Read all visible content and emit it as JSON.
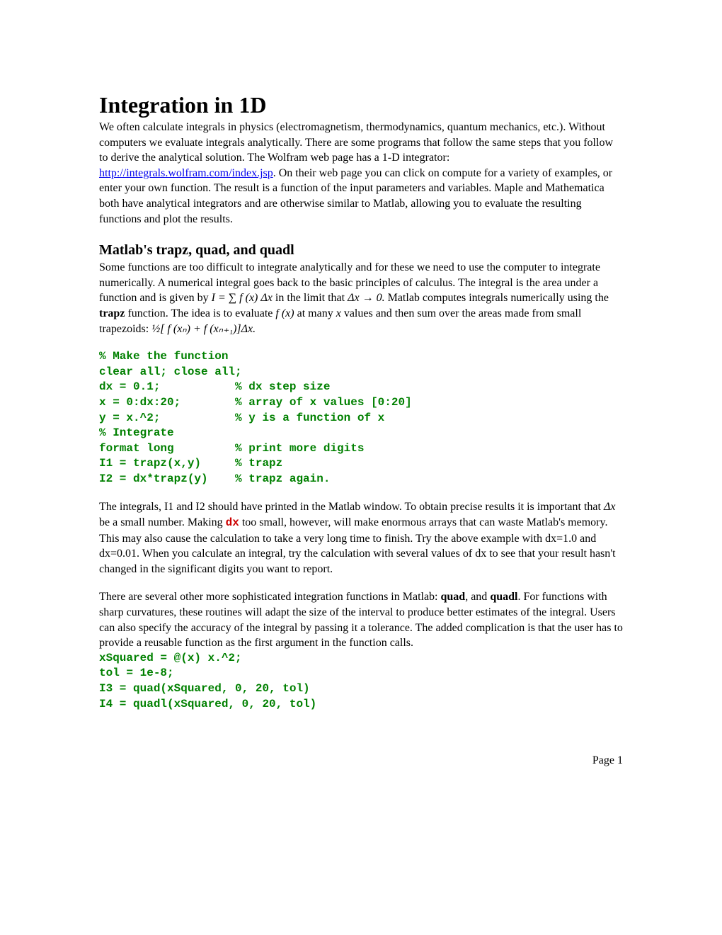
{
  "title": "Integration in 1D",
  "intro_before_link": "We often calculate integrals in physics (electromagnetism, thermodynamics, quantum mechanics, etc.).  Without computers we evaluate integrals analytically.  There are some programs that follow the same steps that you follow to derive the analytical solution.  The Wolfram web page has a 1-D integrator: ",
  "link_text": "http://integrals.wolfram.com/index.jsp",
  "intro_after_link": ".  On their web page you can click on compute for a variety of examples, or enter your own function.  The result is a function of the input parameters and variables.  Maple and Mathematica both have analytical integrators and are otherwise similar to Matlab, allowing you to evaluate the resulting functions and plot the results.",
  "section_heading": "Matlab's trapz, quad, and quadl",
  "section_body": {
    "p1_a": "Some functions are too difficult to integrate analytically and for these we need to use the computer to integrate numerically.  A numerical integral goes back to the basic principles of calculus.  The integral is the area under a function and is given by ",
    "p1_eq": "I = ∑ f (x) Δx",
    "p1_b": " in the limit that ",
    "p1_dx": "Δx → 0.",
    "p1_c": "  Matlab computes integrals numerically using the ",
    "p1_trapz": "trapz",
    "p1_d": " function.  The idea is to evaluate ",
    "p1_fx": "f (x)",
    "p1_e": " at many ",
    "p1_x": "x",
    "p1_f": " values and then sum over the areas made from small trapezoids: ",
    "p1_eq2": "½[ f (xₙ) + f (xₙ₊₁)]Δx."
  },
  "code_block_1": "% Make the function\nclear all; close all;\ndx = 0.1;           % dx step size\nx = 0:dx:20;        % array of x values [0:20]\ny = x.^2;           % y is a function of x\n% Integrate\nformat long         % print more digits\nI1 = trapz(x,y)     % trapz\nI2 = dx*trapz(y)    % trapz again.",
  "para2": {
    "a": "The integrals, I1 and I2 should have printed in the Matlab window.  To obtain precise results it is important that ",
    "dx_math": "Δx",
    "b": " be a small number.  Making ",
    "dx_code": "dx",
    "c": " too small, however, will make enormous arrays that can waste Matlab's memory.  This may also cause the calculation to take a very long time to finish.  Try the above example with dx=1.0 and dx=0.01.  When you calculate an integral, try the calculation with several values of dx to see that your result hasn't changed in the significant digits you want to report."
  },
  "para3": {
    "a": "There are several other more sophisticated integration functions in Matlab: ",
    "quad": "quad",
    "b": ", and ",
    "quadl": "quadl",
    "c": ".  For functions with sharp curvatures, these routines will adapt the size of the interval to produce better estimates of the integral.  Users can also specify the accuracy of the integral by passing it a tolerance.  The added complication is that the user has to provide a reusable function as the first argument in the function calls."
  },
  "code_block_2": "xSquared = @(x) x.^2;\ntol = 1e-8;\nI3 = quad(xSquared, 0, 20, tol)\nI4 = quadl(xSquared, 0, 20, tol)",
  "footer": "Page 1"
}
